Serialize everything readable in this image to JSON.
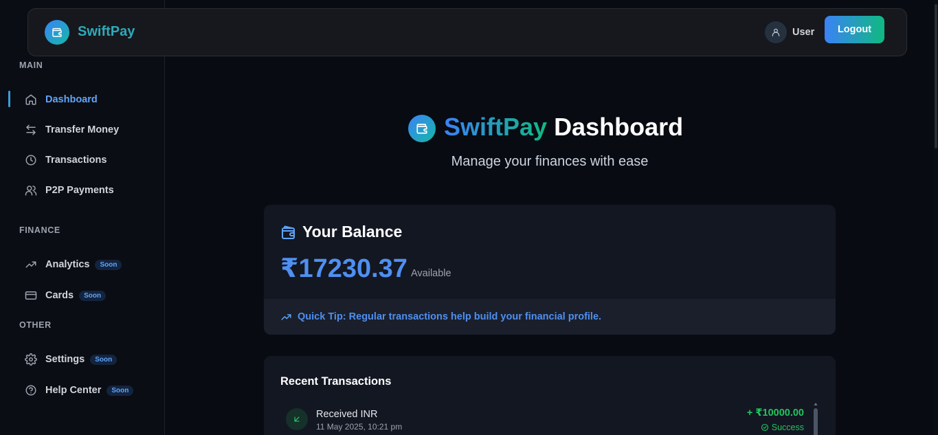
{
  "header": {
    "brand": "SwiftPay",
    "user_label": "User",
    "logout_label": "Logout"
  },
  "sidebar": {
    "sections": {
      "main": "MAIN",
      "finance": "FINANCE",
      "other": "OTHER"
    },
    "items": [
      {
        "label": "Dashboard",
        "icon": "home-icon",
        "active": true
      },
      {
        "label": "Transfer Money",
        "icon": "arrows-left-right-icon"
      },
      {
        "label": "Transactions",
        "icon": "clock-icon"
      },
      {
        "label": "P2P Payments",
        "icon": "users-icon"
      },
      {
        "label": "Analytics",
        "icon": "trending-up-icon",
        "badge": "Soon"
      },
      {
        "label": "Cards",
        "icon": "credit-card-icon",
        "badge": "Soon"
      },
      {
        "label": "Settings",
        "icon": "gear-icon",
        "badge": "Soon"
      },
      {
        "label": "Help Center",
        "icon": "help-circle-icon",
        "badge": "Soon"
      }
    ]
  },
  "hero": {
    "title_brand": "SwiftPay",
    "title_rest": "Dashboard",
    "subtitle": "Manage your finances with ease"
  },
  "balance": {
    "title": "Your Balance",
    "amount": "₹17230.37",
    "available_label": "Available",
    "tip": "Quick Tip: Regular transactions help build your financial profile."
  },
  "transactions": {
    "title": "Recent Transactions",
    "items": [
      {
        "name": "Received INR",
        "date": "11 May 2025, 10:21 pm",
        "amount": "+ ₹10000.00",
        "status": "Success"
      }
    ]
  },
  "colors": {
    "background": "#090b12",
    "accent_blue": "#3b82f6",
    "accent_green": "#10b981",
    "success": "#22c55e"
  }
}
